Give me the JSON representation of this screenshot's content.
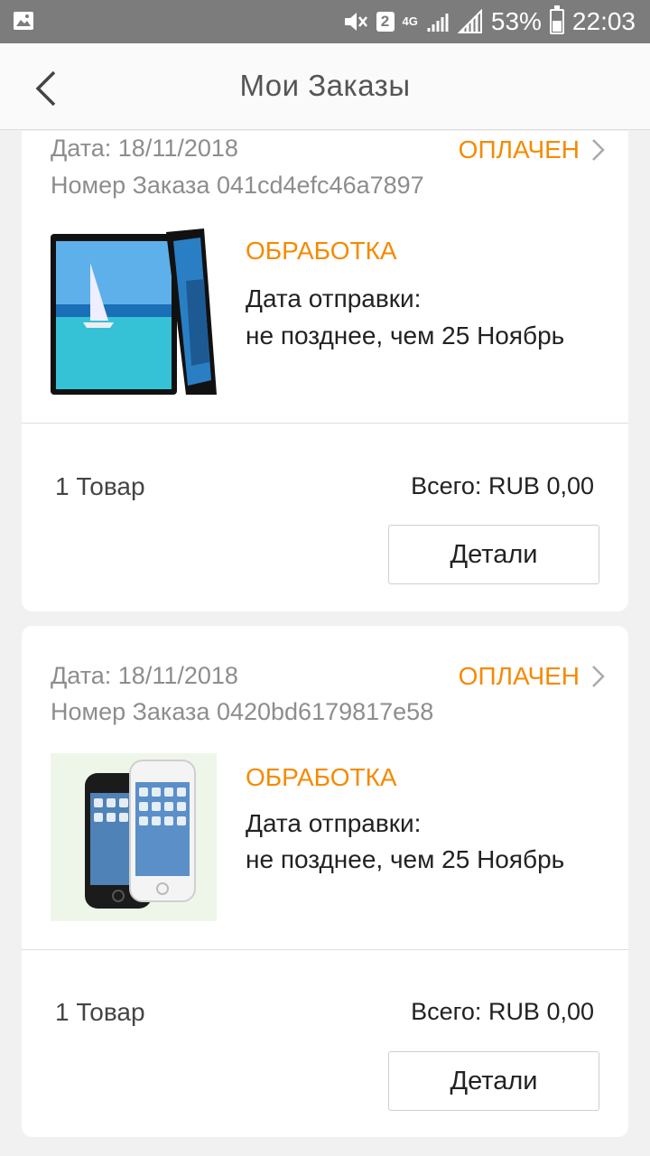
{
  "status_bar": {
    "sim_badge": "2",
    "network": "4G",
    "battery": "53%",
    "time": "22:03"
  },
  "header": {
    "title": "Мои Заказы"
  },
  "orders": [
    {
      "date": "Дата: 18/11/2018",
      "number": "Номер Заказа 041cd4efc46a7897",
      "payment_status": "ОПЛАЧЕН",
      "status": "ОБРАБОТКА",
      "ship_label": "Дата отправки:",
      "ship_value": "не позднее, чем 25 Ноябрь",
      "qty": "1 Товар",
      "total": "Всего: RUB 0,00",
      "details_label": "Детали"
    },
    {
      "date": "Дата: 18/11/2018",
      "number": "Номер Заказа 0420bd6179817e58",
      "payment_status": "ОПЛАЧЕН",
      "status": "ОБРАБОТКА",
      "ship_label": "Дата отправки:",
      "ship_value": "не позднее, чем 25 Ноябрь",
      "qty": "1 Товар",
      "total": "Всего: RUB 0,00",
      "details_label": "Детали"
    }
  ]
}
